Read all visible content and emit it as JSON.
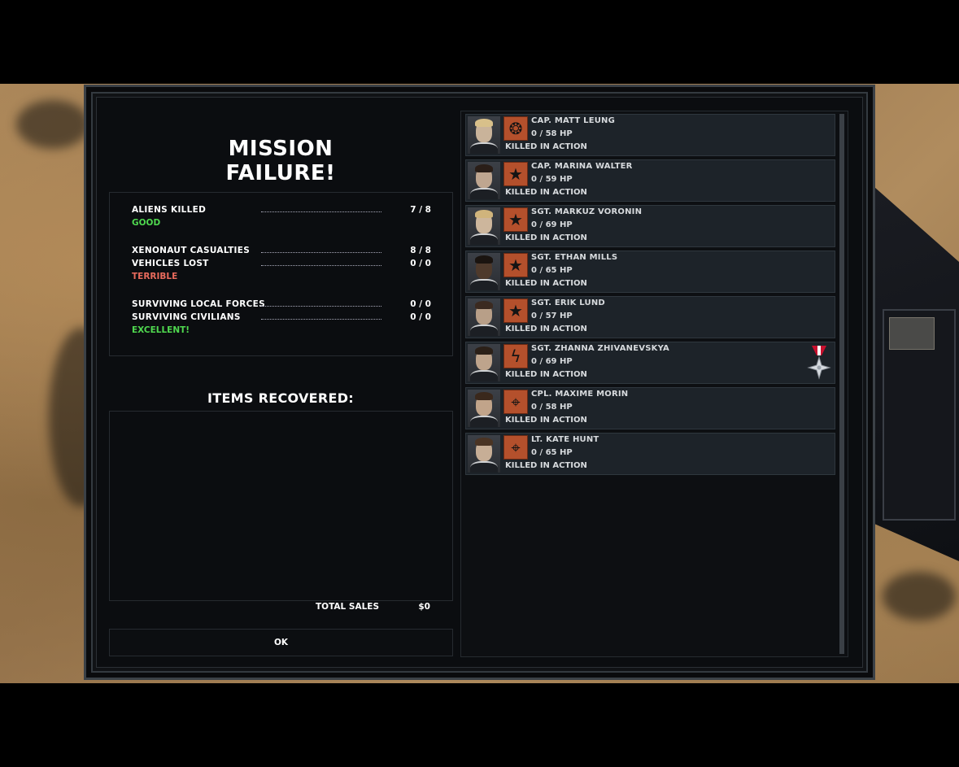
{
  "window": {
    "title": "MISSION FAILURE!"
  },
  "stats": {
    "aliens_killed_label": "ALIENS KILLED",
    "aliens_killed_value": "7 / 8",
    "aliens_rating": "GOOD",
    "casualties_label": "XENONAUT CASUALTIES",
    "casualties_value": "8 / 8",
    "vehicles_label": "VEHICLES LOST",
    "vehicles_value": "0 / 0",
    "losses_rating": "TERRIBLE",
    "local_forces_label": "SURVIVING LOCAL FORCES",
    "local_forces_value": "0 / 0",
    "civilians_label": "SURVIVING CIVILIANS",
    "civilians_value": "0 / 0",
    "civilian_rating": "EXCELLENT!",
    "colors": {
      "good": "#4fd84f",
      "terrible": "#e86a5c",
      "excellent": "#4fd84f"
    }
  },
  "items": {
    "title": "ITEMS RECOVERED:",
    "total_label": "TOTAL SALES",
    "total_value": "$0"
  },
  "buttons": {
    "ok": "OK"
  },
  "soldiers": [
    {
      "name": "CAP. MATT LEUNG",
      "hp": "0 / 58 HP",
      "status": "KILLED IN ACTION",
      "rank_icon": "grenade-icon"
    },
    {
      "name": "CAP. MARINA WALTER",
      "hp": "0 / 59 HP",
      "status": "KILLED IN ACTION",
      "rank_icon": "star-icon"
    },
    {
      "name": "SGT. MARKUZ VORONIN",
      "hp": "0 / 69 HP",
      "status": "KILLED IN ACTION",
      "rank_icon": "star-icon"
    },
    {
      "name": "SGT. ETHAN MILLS",
      "hp": "0 / 65 HP",
      "status": "KILLED IN ACTION",
      "rank_icon": "star-icon"
    },
    {
      "name": "SGT. ERIK LUND",
      "hp": "0 / 57 HP",
      "status": "KILLED IN ACTION",
      "rank_icon": "star-icon"
    },
    {
      "name": "SGT. ZHANNA ZHIVANEVSKYA",
      "hp": "0 / 69 HP",
      "status": "KILLED IN ACTION",
      "rank_icon": "lightning-icon",
      "medal": "cross-medal-icon"
    },
    {
      "name": "CPL. MAXIME MORIN",
      "hp": "0 / 58 HP",
      "status": "KILLED IN ACTION",
      "rank_icon": "crosshair-icon"
    },
    {
      "name": "LT. KATE HUNT",
      "hp": "0 / 65 HP",
      "status": "KILLED IN ACTION",
      "rank_icon": "crosshair-icon"
    }
  ]
}
